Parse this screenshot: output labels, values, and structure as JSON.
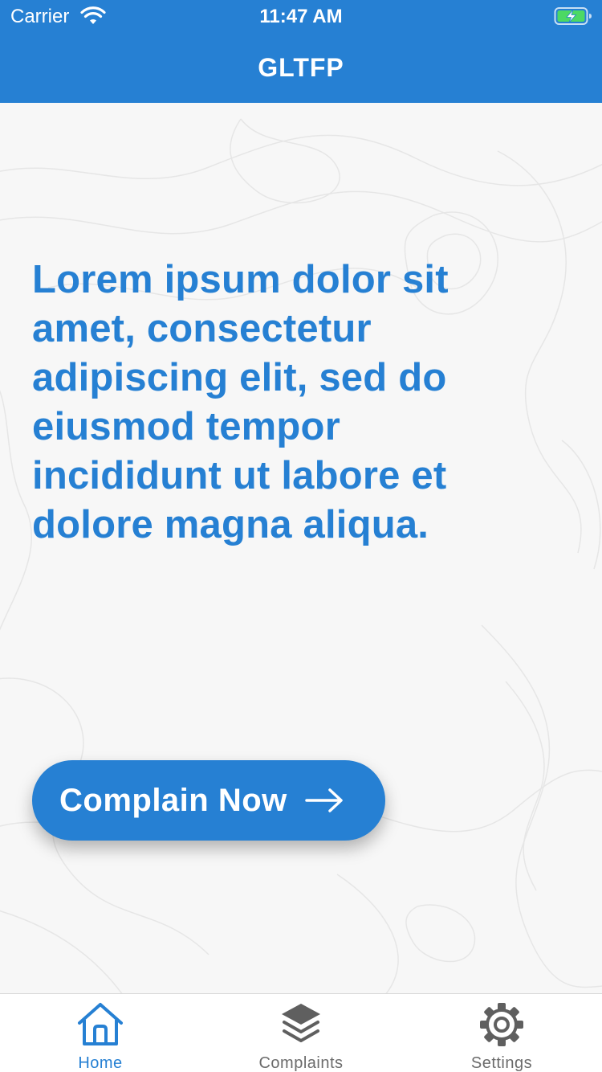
{
  "status_bar": {
    "carrier": "Carrier",
    "time": "11:47 AM"
  },
  "header": {
    "title": "GLTFP"
  },
  "main": {
    "headline": "Lorem ipsum dolor sit amet, consectetur adipiscing elit, sed do eiusmod tempor incididunt ut labore et dolore magna aliqua.",
    "cta_label": "Complain Now"
  },
  "tabs": [
    {
      "label": "Home",
      "icon": "home-icon",
      "active": true
    },
    {
      "label": "Complaints",
      "icon": "layers-icon",
      "active": false
    },
    {
      "label": "Settings",
      "icon": "gear-icon",
      "active": false
    }
  ],
  "colors": {
    "primary": "#2680d3",
    "background": "#f7f7f7",
    "tab_inactive": "#6b6b6b",
    "battery_charge": "#4cd964"
  }
}
